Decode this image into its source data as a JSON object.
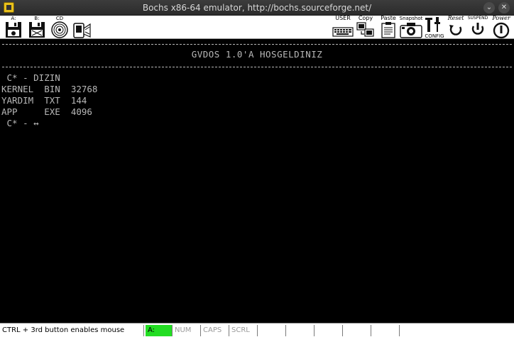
{
  "window": {
    "title": "Bochs x86-64 emulator, http://bochs.sourceforge.net/",
    "minimize_glyph": "⌄",
    "close_glyph": "✕"
  },
  "toolbar": {
    "floppy_a": {
      "label": "A:",
      "icon": "floppy-disk-icon"
    },
    "floppy_b": {
      "label": "B:",
      "icon": "floppy-disk-icon"
    },
    "cdrom": {
      "label": "CD",
      "icon": "cd-rom-icon"
    },
    "usb": {
      "label": "",
      "icon": "usb-device-icon"
    },
    "user": {
      "label": "USER",
      "icon": "keyboard-icon"
    },
    "copy": {
      "label": "Copy",
      "icon": "copy-icon"
    },
    "paste": {
      "label": "Paste",
      "icon": "paste-icon"
    },
    "snapshot": {
      "label": "Snapshot",
      "icon": "camera-icon"
    },
    "config": {
      "label": "CONFIG",
      "icon": "config-tools-icon"
    },
    "reset": {
      "label": "Reset",
      "icon": "reset-icon"
    },
    "suspend": {
      "label": "SUSPEND",
      "icon": "suspend-icon"
    },
    "power": {
      "label": "Power",
      "icon": "power-icon"
    }
  },
  "terminal": {
    "welcome": "GVDOS 1.0'A HOSGELDINIZ",
    "lines": [
      " C* - DIZIN",
      "KERNEL  BIN  32768",
      "YARDIM  TXT  144",
      "APP     EXE  4096"
    ],
    "prompt": " C* - ",
    "cursor": "↔"
  },
  "statusbar": {
    "message": "CTRL + 3rd button enables mouse",
    "indicators": [
      {
        "label": "A:",
        "active": true
      },
      {
        "label": "NUM",
        "active": false
      },
      {
        "label": "CAPS",
        "active": false
      },
      {
        "label": "SCRL",
        "active": false
      },
      {
        "label": "",
        "active": false
      },
      {
        "label": "",
        "active": false
      },
      {
        "label": "",
        "active": false
      },
      {
        "label": "",
        "active": false
      },
      {
        "label": "",
        "active": false
      }
    ]
  }
}
